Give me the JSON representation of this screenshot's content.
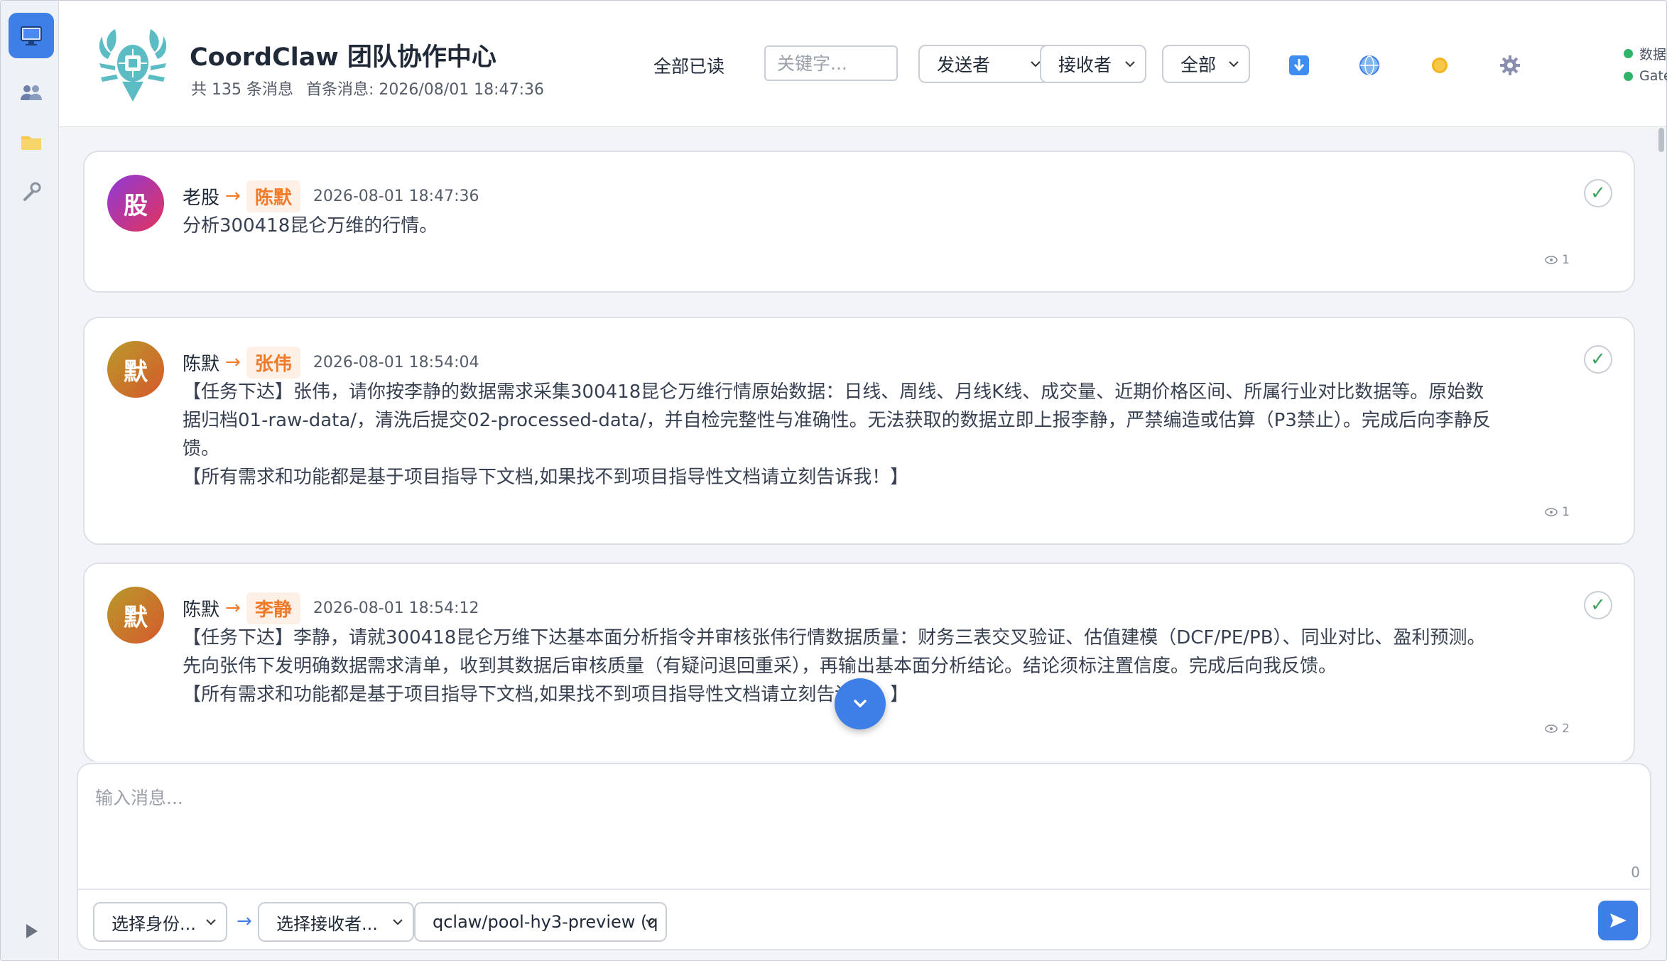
{
  "app": {
    "title": "CoordClaw 团队协作中心",
    "total": "共 135 条消息",
    "first": "首条消息: 2026/08/01 18:47:36"
  },
  "toolbar": {
    "mark_all_read": "全部已读",
    "keyword_placeholder": "关键字...",
    "sender_select": "发送者",
    "receiver_select": "接收者",
    "scope_select": "全部",
    "icons": [
      "download-icon",
      "globe-icon",
      "theme-sun-icon",
      "settings-gear-icon"
    ]
  },
  "status": {
    "dataflow": "数据流",
    "gateway": "Gateway",
    "color": "#2fb26a"
  },
  "sidebar": {
    "items": [
      "monitor-icon",
      "team-icon",
      "folder-icon",
      "tools-icon"
    ],
    "active_color": "#3d7fe6"
  },
  "messages": [
    {
      "avatar": "股",
      "avatar_color": "#c0338f",
      "sender": "老股",
      "arrow": "→",
      "receiver": "陈默",
      "time": "2026-08-01 18:47:36",
      "body": [
        "分析300418昆仑万维的行情。"
      ],
      "views": "1"
    },
    {
      "avatar": "默",
      "avatar_color": "#c9772f",
      "sender": "陈默",
      "arrow": "→",
      "receiver": "张伟",
      "time": "2026-08-01 18:54:04",
      "body": [
        "【任务下达】张伟，请你按李静的数据需求采集300418昆仑万维行情原始数据：日线、周线、月线K线、成交量、近期价格区间、所属行业对比数据等。原始数",
        "据归档01-raw-data/，清洗后提交02-processed-data/，并自检完整性与准确性。无法获取的数据立即上报李静，严禁编造或估算（P3禁止）。完成后向李静反",
        "馈。",
        "【所有需求和功能都是基于项目指导下文档,如果找不到项目指导性文档请立刻告诉我！】"
      ],
      "views": "1"
    },
    {
      "avatar": "默",
      "avatar_color": "#c9772f",
      "sender": "陈默",
      "arrow": "→",
      "receiver": "李静",
      "time": "2026-08-01 18:54:12",
      "body": [
        "【任务下达】李静，请就300418昆仑万维下达基本面分析指令并审核张伟行情数据质量：财务三表交叉验证、估值建模（DCF/PE/PB）、同业对比、盈利预测。",
        "先向张伟下发明确数据需求清单，收到其数据后审核质量（有疑问退回重采），再输出基本面分析结论。结论须标注置信度。完成后向我反馈。",
        "【所有需求和功能都是基于项目指导下文档,如果找不到项目指导性文档请立刻告诉我！】"
      ],
      "views": "2"
    }
  ],
  "composer": {
    "placeholder": "输入消息...",
    "count": "0",
    "identity_select": "选择身份...",
    "arrow": "→",
    "receiver_select": "选择接收者...",
    "model_select": "qclaw/pool-hy3-preview (q"
  }
}
